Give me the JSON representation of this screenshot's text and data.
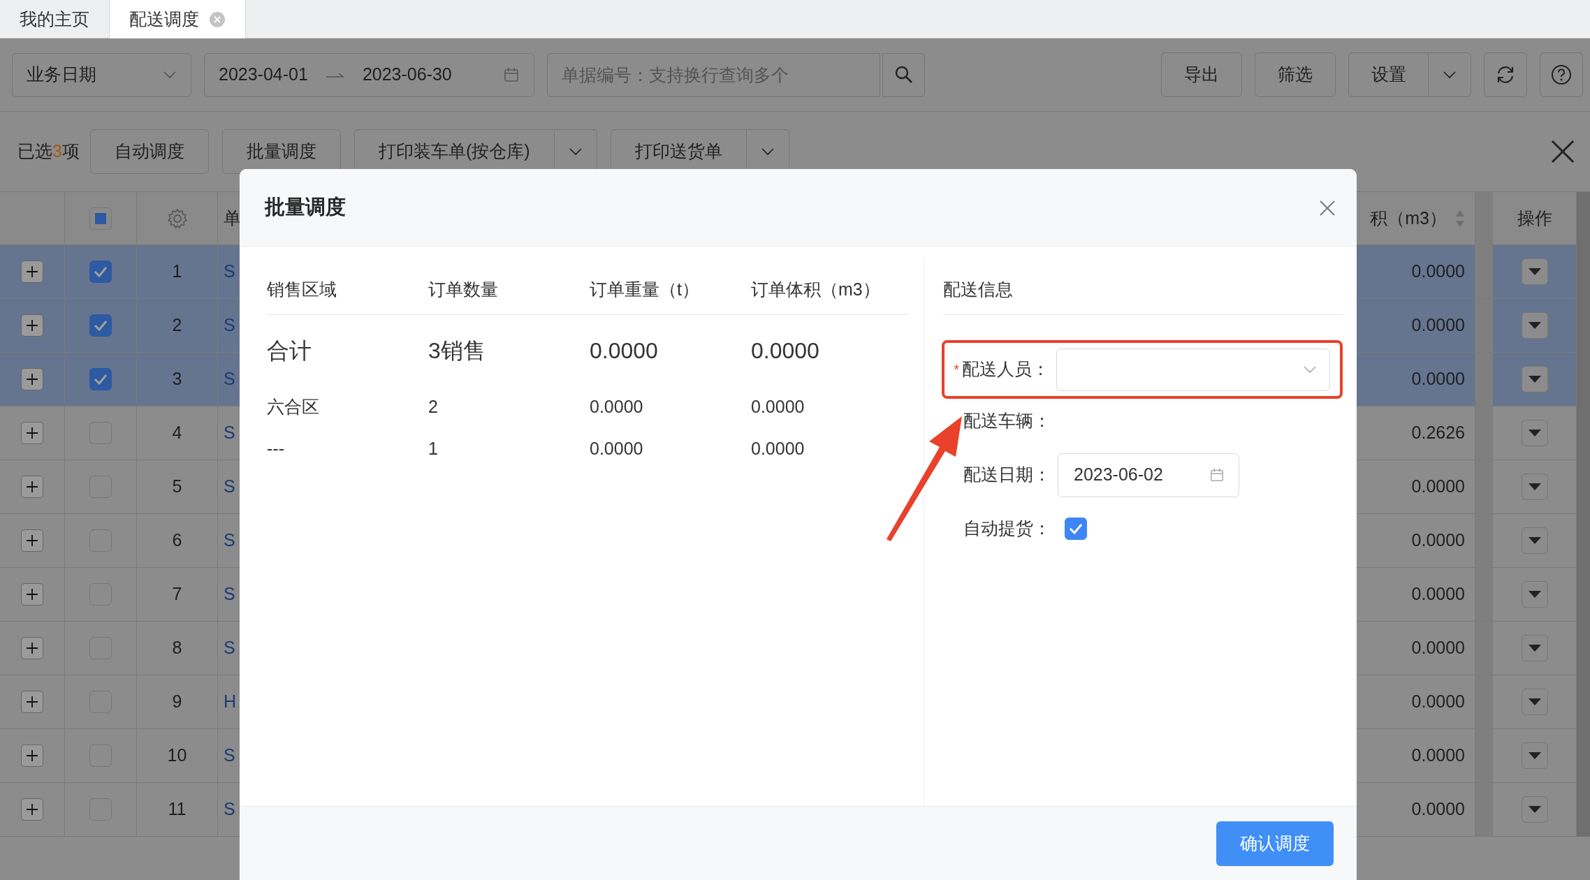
{
  "tabs": [
    {
      "label": "我的主页",
      "selected": false
    },
    {
      "label": "配送调度",
      "selected": true,
      "closable": true
    }
  ],
  "toolbar": {
    "date_type": "业务日期",
    "date_start": "2023-04-01",
    "date_end": "2023-06-30",
    "search": {
      "placeholder": "单据编号：支持换行查询多个"
    },
    "buttons": [
      "导出",
      "筛选"
    ],
    "settings_button": "设置"
  },
  "selection_bar": {
    "prefix": "已选",
    "count": "3",
    "suffix": "项",
    "buttons": [
      {
        "label": "自动调度"
      },
      {
        "label": "批量调度"
      },
      {
        "label": "打印装车单(按仓库)",
        "split": true
      },
      {
        "label": "打印送货单",
        "split": true
      }
    ]
  },
  "table": {
    "header_checkbox_indeterminate": true,
    "columns": [
      "单",
      "积（m3）",
      "操作"
    ],
    "rows": [
      {
        "index": "1",
        "selected": true,
        "column_4": "S",
        "volume": "0.0000"
      },
      {
        "index": "2",
        "selected": true,
        "column_4": "S",
        "volume": "0.0000"
      },
      {
        "index": "3",
        "selected": true,
        "column_4": "S",
        "volume": "0.0000"
      },
      {
        "index": "4",
        "selected": false,
        "column_4": "S",
        "volume": "0.2626"
      },
      {
        "index": "5",
        "selected": false,
        "column_4": "S",
        "volume": "0.0000"
      },
      {
        "index": "6",
        "selected": false,
        "column_4": "S",
        "volume": "0.0000"
      },
      {
        "index": "7",
        "selected": false,
        "column_4": "S",
        "volume": "0.0000"
      },
      {
        "index": "8",
        "selected": false,
        "column_4": "S",
        "volume": "0.0000"
      },
      {
        "index": "9",
        "selected": false,
        "column_4": "H",
        "volume": "0.0000"
      },
      {
        "index": "10",
        "selected": false,
        "column_4": "S",
        "volume": "0.0000"
      },
      {
        "index": "11",
        "selected": false,
        "column_4": "S",
        "volume": "0.0000"
      }
    ]
  },
  "modal": {
    "title": "批量调度",
    "summary": {
      "columns": [
        "销售区域",
        "订单数量",
        "订单重量（t）",
        "订单体积（m3）"
      ],
      "total": [
        "合计",
        "3销售",
        "0.0000",
        "0.0000"
      ],
      "rows": [
        [
          "六合区",
          "2",
          "0.0000",
          "0.0000"
        ],
        [
          "---",
          "1",
          "0.0000",
          "0.0000"
        ]
      ]
    },
    "delivery": {
      "title": "配送信息",
      "fields": [
        {
          "kind": "select",
          "label": "配送人员：",
          "required_mark": "*",
          "highlighted": true
        },
        {
          "kind": "text",
          "label": "配送车辆："
        },
        {
          "kind": "date",
          "label": "配送日期：",
          "value": "2023-06-02"
        },
        {
          "kind": "checkbox",
          "label": "自动提货：",
          "checked": true
        }
      ]
    },
    "confirm_button": "确认调度"
  }
}
